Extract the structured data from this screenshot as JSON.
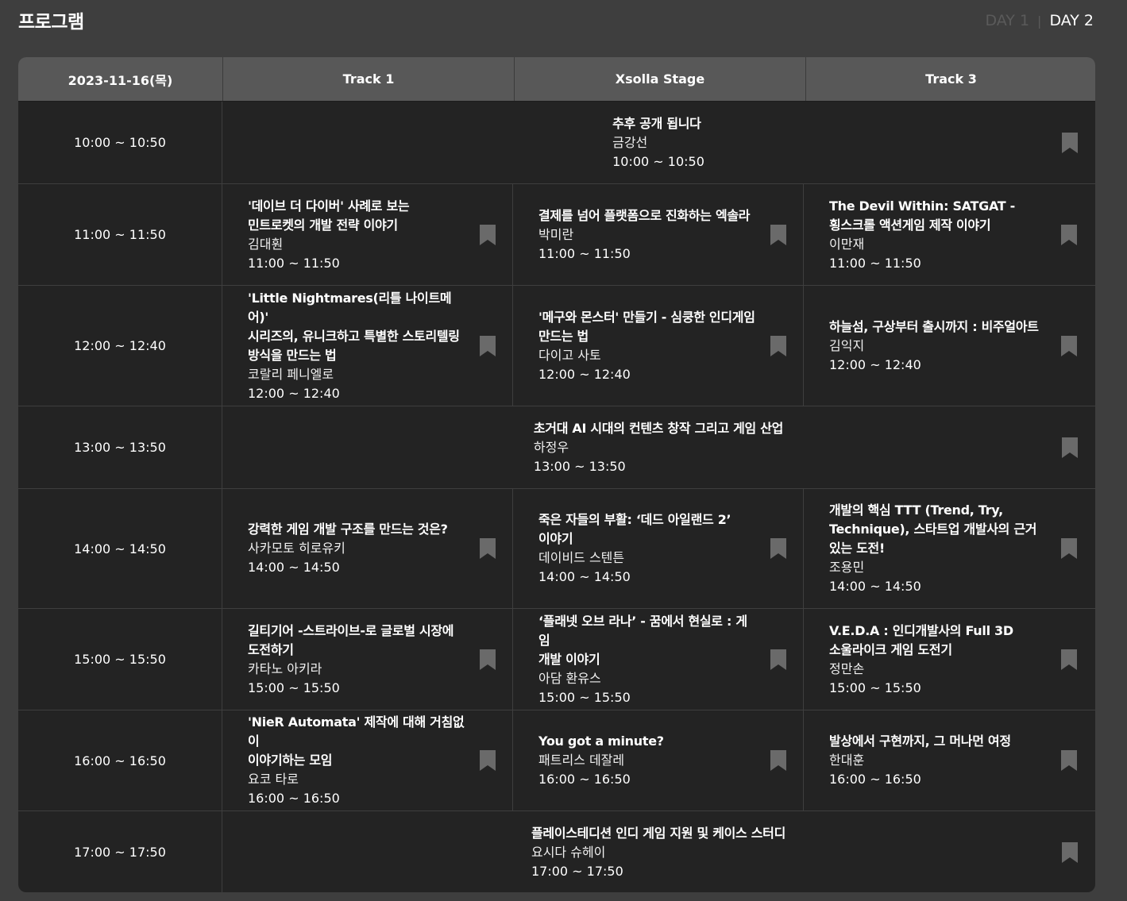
{
  "page": {
    "title": "프로그램"
  },
  "days": {
    "day1": "DAY 1",
    "day2": "DAY 2",
    "separator": "|",
    "active": "DAY 2"
  },
  "header": {
    "date": "2023-11-16(목)",
    "track1": "Track 1",
    "stage": "Xsolla Stage",
    "track3": "Track 3"
  },
  "colors": {
    "background": "#3e3e3e",
    "table": "#232323",
    "header": "#585858",
    "bookmark": "#6a6a6a"
  },
  "icons": {
    "bookmark": "bookmark-icon"
  },
  "rows": [
    {
      "time": "10:00 ~ 10:50",
      "wide": {
        "title": "추후 공개 됩니다",
        "speaker": "금강선",
        "time": "10:00 ~ 10:50"
      }
    },
    {
      "time": "11:00 ~ 11:50",
      "sessions": [
        {
          "title": "'데이브 더 다이버' 사례로 보는\n민트로켓의 개발 전략 이야기",
          "speaker": "김대훤",
          "time": "11:00 ~ 11:50"
        },
        {
          "title": "결제를 넘어 플랫폼으로 진화하는 엑솔라",
          "speaker": "박미란",
          "time": "11:00 ~ 11:50"
        },
        {
          "title": "The Devil Within: SATGAT -\n횡스크롤 액션게임 제작 이야기",
          "speaker": "이만재",
          "time": "11:00 ~ 11:50"
        }
      ]
    },
    {
      "time": "12:00 ~ 12:40",
      "sessions": [
        {
          "title": "'Little Nightmares(리틀 나이트메어)'\n시리즈의, 유니크하고 특별한 스토리텔링\n방식을 만드는 법",
          "speaker": "코랄리 페니엘로",
          "time": "12:00 ~ 12:40"
        },
        {
          "title": "'메구와 몬스터' 만들기 - 심쿵한 인디게임\n만드는 법",
          "speaker": "다이고 사토",
          "time": "12:00 ~ 12:40"
        },
        {
          "title": "하늘섬, 구상부터 출시까지 : 비주얼아트",
          "speaker": "김익지",
          "time": "12:00 ~ 12:40"
        }
      ]
    },
    {
      "time": "13:00 ~ 13:50",
      "wide": {
        "title": "초거대 AI 시대의 컨텐츠 창작 그리고 게임 산업",
        "speaker": "하정우",
        "time": "13:00 ~ 13:50"
      }
    },
    {
      "time": "14:00 ~ 14:50",
      "sessions": [
        {
          "title": "강력한 게임 개발 구조를 만드는 것은?",
          "speaker": "사카모토 히로유키",
          "time": "14:00 ~ 14:50"
        },
        {
          "title": "죽은 자들의 부활: ‘데드 아일랜드 2’\n이야기",
          "speaker": "데이비드 스텐튼",
          "time": "14:00 ~ 14:50"
        },
        {
          "title": "개발의 핵심 TTT (Trend, Try,\nTechnique), 스타트업 개발사의 근거\n있는 도전!",
          "speaker": "조용민",
          "time": "14:00 ~ 14:50"
        }
      ]
    },
    {
      "time": "15:00 ~ 15:50",
      "sessions": [
        {
          "title": "길티기어 -스트라이브-로 글로벌 시장에\n도전하기",
          "speaker": "카타노 아키라",
          "time": "15:00 ~ 15:50"
        },
        {
          "title": "‘플래넷 오브 라나’ - 꿈에서 현실로 : 게임\n개발 이야기",
          "speaker": "아담 환유스",
          "time": "15:00 ~ 15:50"
        },
        {
          "title": "V.E.D.A : 인디개발사의 Full 3D\n소울라이크 게임 도전기",
          "speaker": "정만손",
          "time": "15:00 ~ 15:50"
        }
      ]
    },
    {
      "time": "16:00 ~ 16:50",
      "sessions": [
        {
          "title": "'NieR Automata' 제작에 대해 거침없이\n이야기하는 모임",
          "speaker": "요코 타로",
          "time": "16:00 ~ 16:50"
        },
        {
          "title": "You got a minute?",
          "speaker": "패트리스 데잘레",
          "time": "16:00 ~ 16:50"
        },
        {
          "title": "발상에서 구현까지, 그 머나먼 여정",
          "speaker": "한대훈",
          "time": "16:00 ~ 16:50"
        }
      ]
    },
    {
      "time": "17:00 ~ 17:50",
      "wide": {
        "title": "플레이스테디션 인디 게임 지원 및 케이스 스터디",
        "speaker": "요시다 슈헤이",
        "time": "17:00 ~ 17:50"
      }
    }
  ]
}
